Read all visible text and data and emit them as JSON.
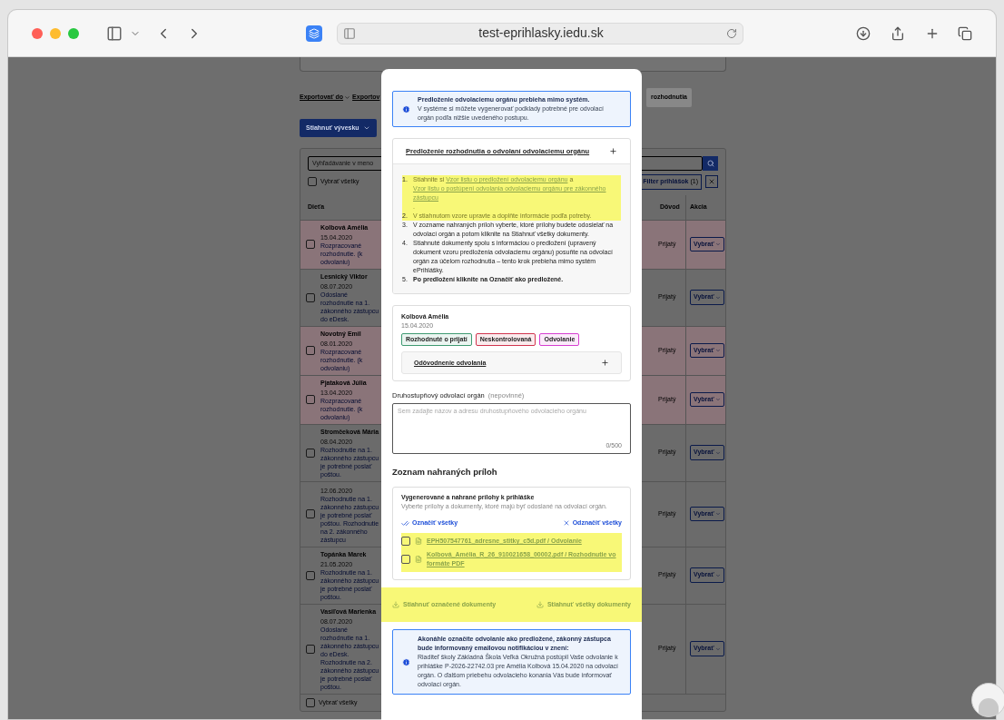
{
  "browser": {
    "url": "test-eprihlasky.iedu.sk"
  },
  "background": {
    "toolbar": {
      "export_links": [
        "Exportovať do",
        "Exportov"
      ],
      "cut_button": "rozhodnutia",
      "download_button": "Stiahnuť vývesku"
    },
    "search": {
      "placeholder": "Vyhľadávanie v meno"
    },
    "select_all_top": {
      "label": "Vybrať všetky",
      "checked": false
    },
    "filter_button": {
      "label": "Filter prihlášok",
      "count": "(1)"
    },
    "columns": [
      "Dieťa",
      "Dôvod",
      "Akcia"
    ],
    "rows": [
      {
        "name": "Kolbová Amélia",
        "date": "15.04.2020",
        "status": "Rozpracované rozhodnutie. (k odvolaniu)",
        "flagged": true,
        "checked": false,
        "reason": "Prijatý",
        "action": "Vybrať"
      },
      {
        "name": "Lesnický Viktor",
        "date": "08.07.2020",
        "status": "Odoslané rozhodnutie na 1. zákonného zástupcu do eDesk.",
        "flagged": false,
        "checked": false,
        "reason": "Prijatý",
        "action": "Vybrať"
      },
      {
        "name": "Novotný Emil",
        "date": "08.01.2020",
        "status": "Rozpracované rozhodnutie. (k odvolaniu)",
        "flagged": true,
        "checked": false,
        "reason": "Prijatý",
        "action": "Vybrať"
      },
      {
        "name": "Pjataková Júlia",
        "date": "13.04.2020",
        "status": "Rozpracované rozhodnutie. (k odvolaniu)",
        "flagged": true,
        "checked": false,
        "reason": "Prijatý",
        "action": "Vybrať"
      },
      {
        "name": "Stromčeková Mária",
        "date": "08.04.2020",
        "status": "Rozhodnutie na 1. zákonného zástupcu je potrebné poslať poštou.",
        "flagged": false,
        "checked": false,
        "reason": "Prijatý",
        "action": "Vybrať"
      },
      {
        "date": "12.06.2020",
        "status": "Rozhodnutie na 1. zákonného zástupcu je potrebné poslať poštou. Rozhodnutie na 2. zákonného zástupcu",
        "flagged": false,
        "checked": false,
        "reason": "Prijatý",
        "action": "Vybrať"
      },
      {
        "name": "Topánka Marek",
        "date": "21.05.2020",
        "status": "Rozhodnutie na 1. zákonného zástupcu je potrebné poslať poštou.",
        "flagged": false,
        "checked": false,
        "reason": "Prijatý",
        "action": "Vybrať"
      },
      {
        "name": "Vasiľová Marienka",
        "date": "08.07.2020",
        "status": "Odoslané rozhodnutie na 1. zákonného zástupcu do eDesk. Rozhodnutie na 2. zákonného zástupcu je potrebné poslať poštou.",
        "flagged": false,
        "checked": false,
        "reason": "Prijatý",
        "action": "Vybrať"
      }
    ],
    "select_all_bottom": {
      "label": "Vybrať všetky",
      "checked": false
    }
  },
  "modal": {
    "notice": {
      "title": "Predloženie odvolaciemu orgánu prebieha mimo systém.",
      "text": "V systéme si môžete vygenerovať podklady potrebné pre odvolací orgán podľa nižšie uvedeného postupu."
    },
    "instructions": {
      "title": "Predloženie rozhodnutia o odvolaní odvolaciemu orgánu",
      "expanded": true,
      "steps": [
        {
          "number": "1.",
          "highlighted": true,
          "bold": false,
          "segments": [
            {
              "kind": "text",
              "text": "Stiahnite si "
            },
            {
              "kind": "link",
              "text": "Vzor listu o predložení odvolaciemu orgánu"
            },
            {
              "kind": "text",
              "text": " a "
            },
            {
              "kind": "link",
              "text": "Vzor listu o postúpení odvolania odvolaciemu orgánu pre zákonného zástupcu"
            },
            {
              "kind": "text",
              "text": "."
            }
          ]
        },
        {
          "number": "2.",
          "highlighted": true,
          "bold": false,
          "segments": [
            {
              "kind": "text",
              "text": "V stiahnutom vzore upravte a doplňte informácie podľa potreby."
            }
          ]
        },
        {
          "number": "3.",
          "highlighted": false,
          "bold": false,
          "segments": [
            {
              "kind": "text",
              "text": "V zozname nahraných príloh vyberte, ktoré prílohy budete odosielať na odvolací orgán a potom kliknite na Stiahnuť všetky dokumenty."
            }
          ]
        },
        {
          "number": "4.",
          "highlighted": false,
          "bold": false,
          "segments": [
            {
              "kind": "text",
              "text": "Stiahnuté dokumenty spolu s informáciou o predložení (upravený dokument vzoru predloženia odvolaciemu orgánu) posuňte na odvolací orgán za účelom rozhodnutia – tento krok prebieha mimo systém ePrihlášky."
            }
          ]
        },
        {
          "number": "5.",
          "highlighted": false,
          "bold": true,
          "segments": [
            {
              "kind": "text",
              "text": "Po predložení kliknite na Označiť ako predložené."
            }
          ]
        }
      ]
    },
    "applicant": {
      "name": "Kolbová Amélia",
      "date": "15.04.2020",
      "tags": [
        {
          "label": "Rozhodnuté o prijatí",
          "color": "#3f9a72"
        },
        {
          "label": "Neskontrolovaná",
          "color": "#d1364f"
        },
        {
          "label": "Odvolanie",
          "color": "#d63fd1"
        }
      ],
      "justification": {
        "title": "Odôvodnenie odvolania",
        "expanded": false
      }
    },
    "authority_field": {
      "label": "Druhostupňový odvolací orgán",
      "hint": "(nepovinné)",
      "placeholder": "Sem zadajte názov a adresu druhostupňového odvolacieho orgánu",
      "counter": "0/500"
    },
    "attachments_heading": "Zoznam nahraných príloh",
    "attachments": {
      "title": "Vygenerované a nahrané prílohy k prihláške",
      "description": "Vyberte prílohy a dokumenty, ktoré majú byť odoslané na odvolací orgán.",
      "select_all": "Označiť všetky",
      "deselect_all": "Odznačiť všetky",
      "highlighted": true,
      "files": [
        {
          "label": "EPH507547761_adresne_stitky_c5d.pdf / Odvolanie",
          "checked": false
        },
        {
          "label": "Kolbová_Amélia_R_26_910021658_00002.pdf / Rozhodnutie vo formáte PDF",
          "checked": false
        }
      ]
    },
    "downloads": {
      "highlighted": true,
      "buttons": [
        "Stiahnuť označené dokumenty",
        "Stiahnuť všetky dokumenty"
      ]
    },
    "notification": {
      "title": "Akonáhle označíte odvolanie ako predložené, zákonný zástupca bude informovaný emailovou notifikáciou v znení:",
      "text": "Riaditeľ školy Základná Škola Veľká Okružná postúpil Vaše odvolanie k prihláške P-2026-22742.03 pre Amélia Kolbová 15.04.2020 na odvolací orgán. O ďalšom priebehu odvolacieho konania Vás bude informovať odvolací orgán."
    }
  }
}
